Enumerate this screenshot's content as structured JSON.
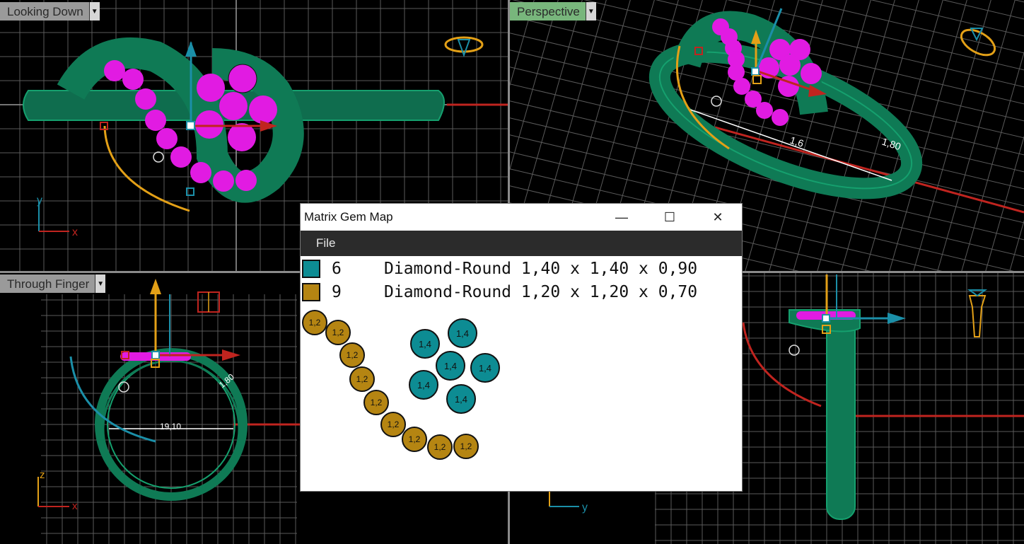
{
  "colors": {
    "teal_gem": "#0d8c93",
    "gold_gem": "#b58512",
    "ring_green": "#11855d",
    "gem_magenta": "#e11be2",
    "axis_red": "#c0241f",
    "axis_gold": "#e3a017",
    "axis_teal": "#1b8fa8",
    "grid_line": "#6e6e6e",
    "persp_label_bg": "#78b67c"
  },
  "viewports": {
    "top": {
      "label": "Looking Down",
      "axis_h": "x",
      "axis_v": "y"
    },
    "persp": {
      "label": "Perspective",
      "dim_label": "1,80",
      "dim_label2": "1,6"
    },
    "front": {
      "label": "Through Finger",
      "dim_label": "19,10",
      "dim_label2": "1,80",
      "axis_h": "x",
      "axis_v": "z"
    },
    "right": {
      "label": "",
      "axis_h": "y"
    }
  },
  "gem_map_window": {
    "title": "Matrix Gem Map",
    "controls": {
      "minimize": "—",
      "maximize": "☐",
      "close": "✕"
    },
    "menu": [
      "File"
    ],
    "legend": [
      {
        "count": "6",
        "desc": "Diamond-Round 1,40 x 1,40 x 0,90",
        "color": "#0d8c93"
      },
      {
        "count": "9",
        "desc": "Diamond-Round 1,20 x 1,20 x 0,70",
        "color": "#b58512"
      }
    ],
    "gold_stones": [
      "1,2",
      "1,2",
      "1,2",
      "1,2",
      "1,2",
      "1,2",
      "1,2",
      "1,2",
      "1,2"
    ],
    "teal_stones": [
      "1,4",
      "1,4",
      "1,4",
      "1,4",
      "1,4",
      "1,4"
    ]
  }
}
